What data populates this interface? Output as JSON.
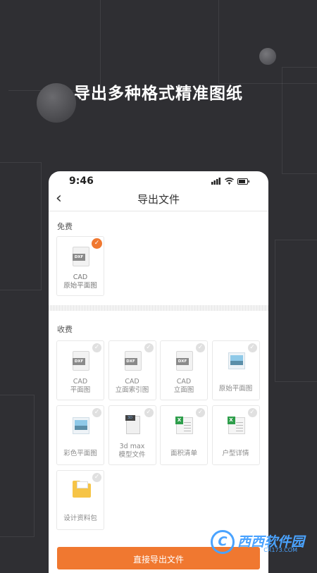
{
  "headline": "导出多种格式精准图纸",
  "status": {
    "time": "9:46"
  },
  "nav": {
    "title": "导出文件"
  },
  "free": {
    "label": "免费",
    "items": [
      {
        "icon": "dxf-file-icon",
        "tag": "DXF",
        "line1": "CAD",
        "line2": "原始平面图",
        "checked": true
      }
    ]
  },
  "paid": {
    "label": "收费",
    "items": [
      {
        "icon": "dxf-file-icon",
        "tag": "DXF",
        "line1": "CAD",
        "line2": "平面图"
      },
      {
        "icon": "dxf-file-icon",
        "tag": "DXF",
        "line1": "CAD",
        "line2": "立面索引图"
      },
      {
        "icon": "dxf-file-icon",
        "tag": "DXF",
        "line1": "CAD",
        "line2": "立面图"
      },
      {
        "icon": "image-file-icon",
        "line1": "原始平面图",
        "line2": ""
      },
      {
        "icon": "image-file-icon",
        "line1": "彩色平面图",
        "line2": ""
      },
      {
        "icon": "3d-model-icon",
        "tag": "3D",
        "line1": "3d max",
        "line2": "模型文件"
      },
      {
        "icon": "excel-file-icon",
        "line1": "面积清单",
        "line2": ""
      },
      {
        "icon": "excel-file-icon",
        "line1": "户型详情",
        "line2": ""
      },
      {
        "icon": "folder-icon",
        "line1": "设计资料包",
        "line2": ""
      }
    ]
  },
  "export_button": "直接导出文件",
  "watermark": {
    "logo": "C",
    "text": "西西软件园",
    "sub": "CR173.COM"
  },
  "colors": {
    "accent": "#f07830",
    "background": "#2f2f33"
  }
}
